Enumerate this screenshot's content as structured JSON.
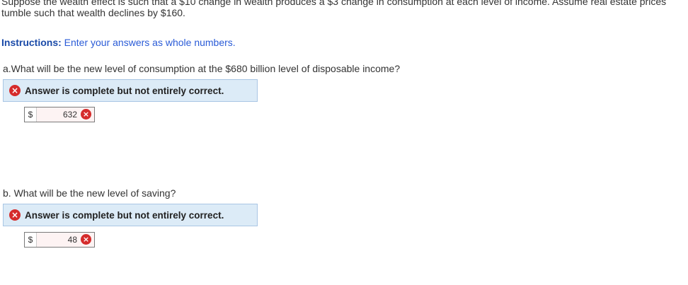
{
  "intro": "Suppose the wealth effect is such that a $10 change in wealth produces a $3 change in consumption at each level of income. Assume real estate prices tumble such that wealth declines by $160.",
  "instructions": {
    "label": "Instructions:",
    "text": "Enter your answers as whole numbers."
  },
  "questions": [
    {
      "text": "a.What will be the new level of consumption at the $680 billion level of disposable income?",
      "status": "Answer is complete but not entirely correct.",
      "currency": "$",
      "value": "632"
    },
    {
      "text": "b. What will be the new level of saving?",
      "status": "Answer is complete but not entirely correct.",
      "currency": "$",
      "value": "48"
    }
  ],
  "colors": {
    "incorrect": "#d52b2b",
    "banner_bg": "#dcebf7",
    "instructions": "#2a5bd7"
  },
  "icons": {
    "incorrect": "×"
  }
}
